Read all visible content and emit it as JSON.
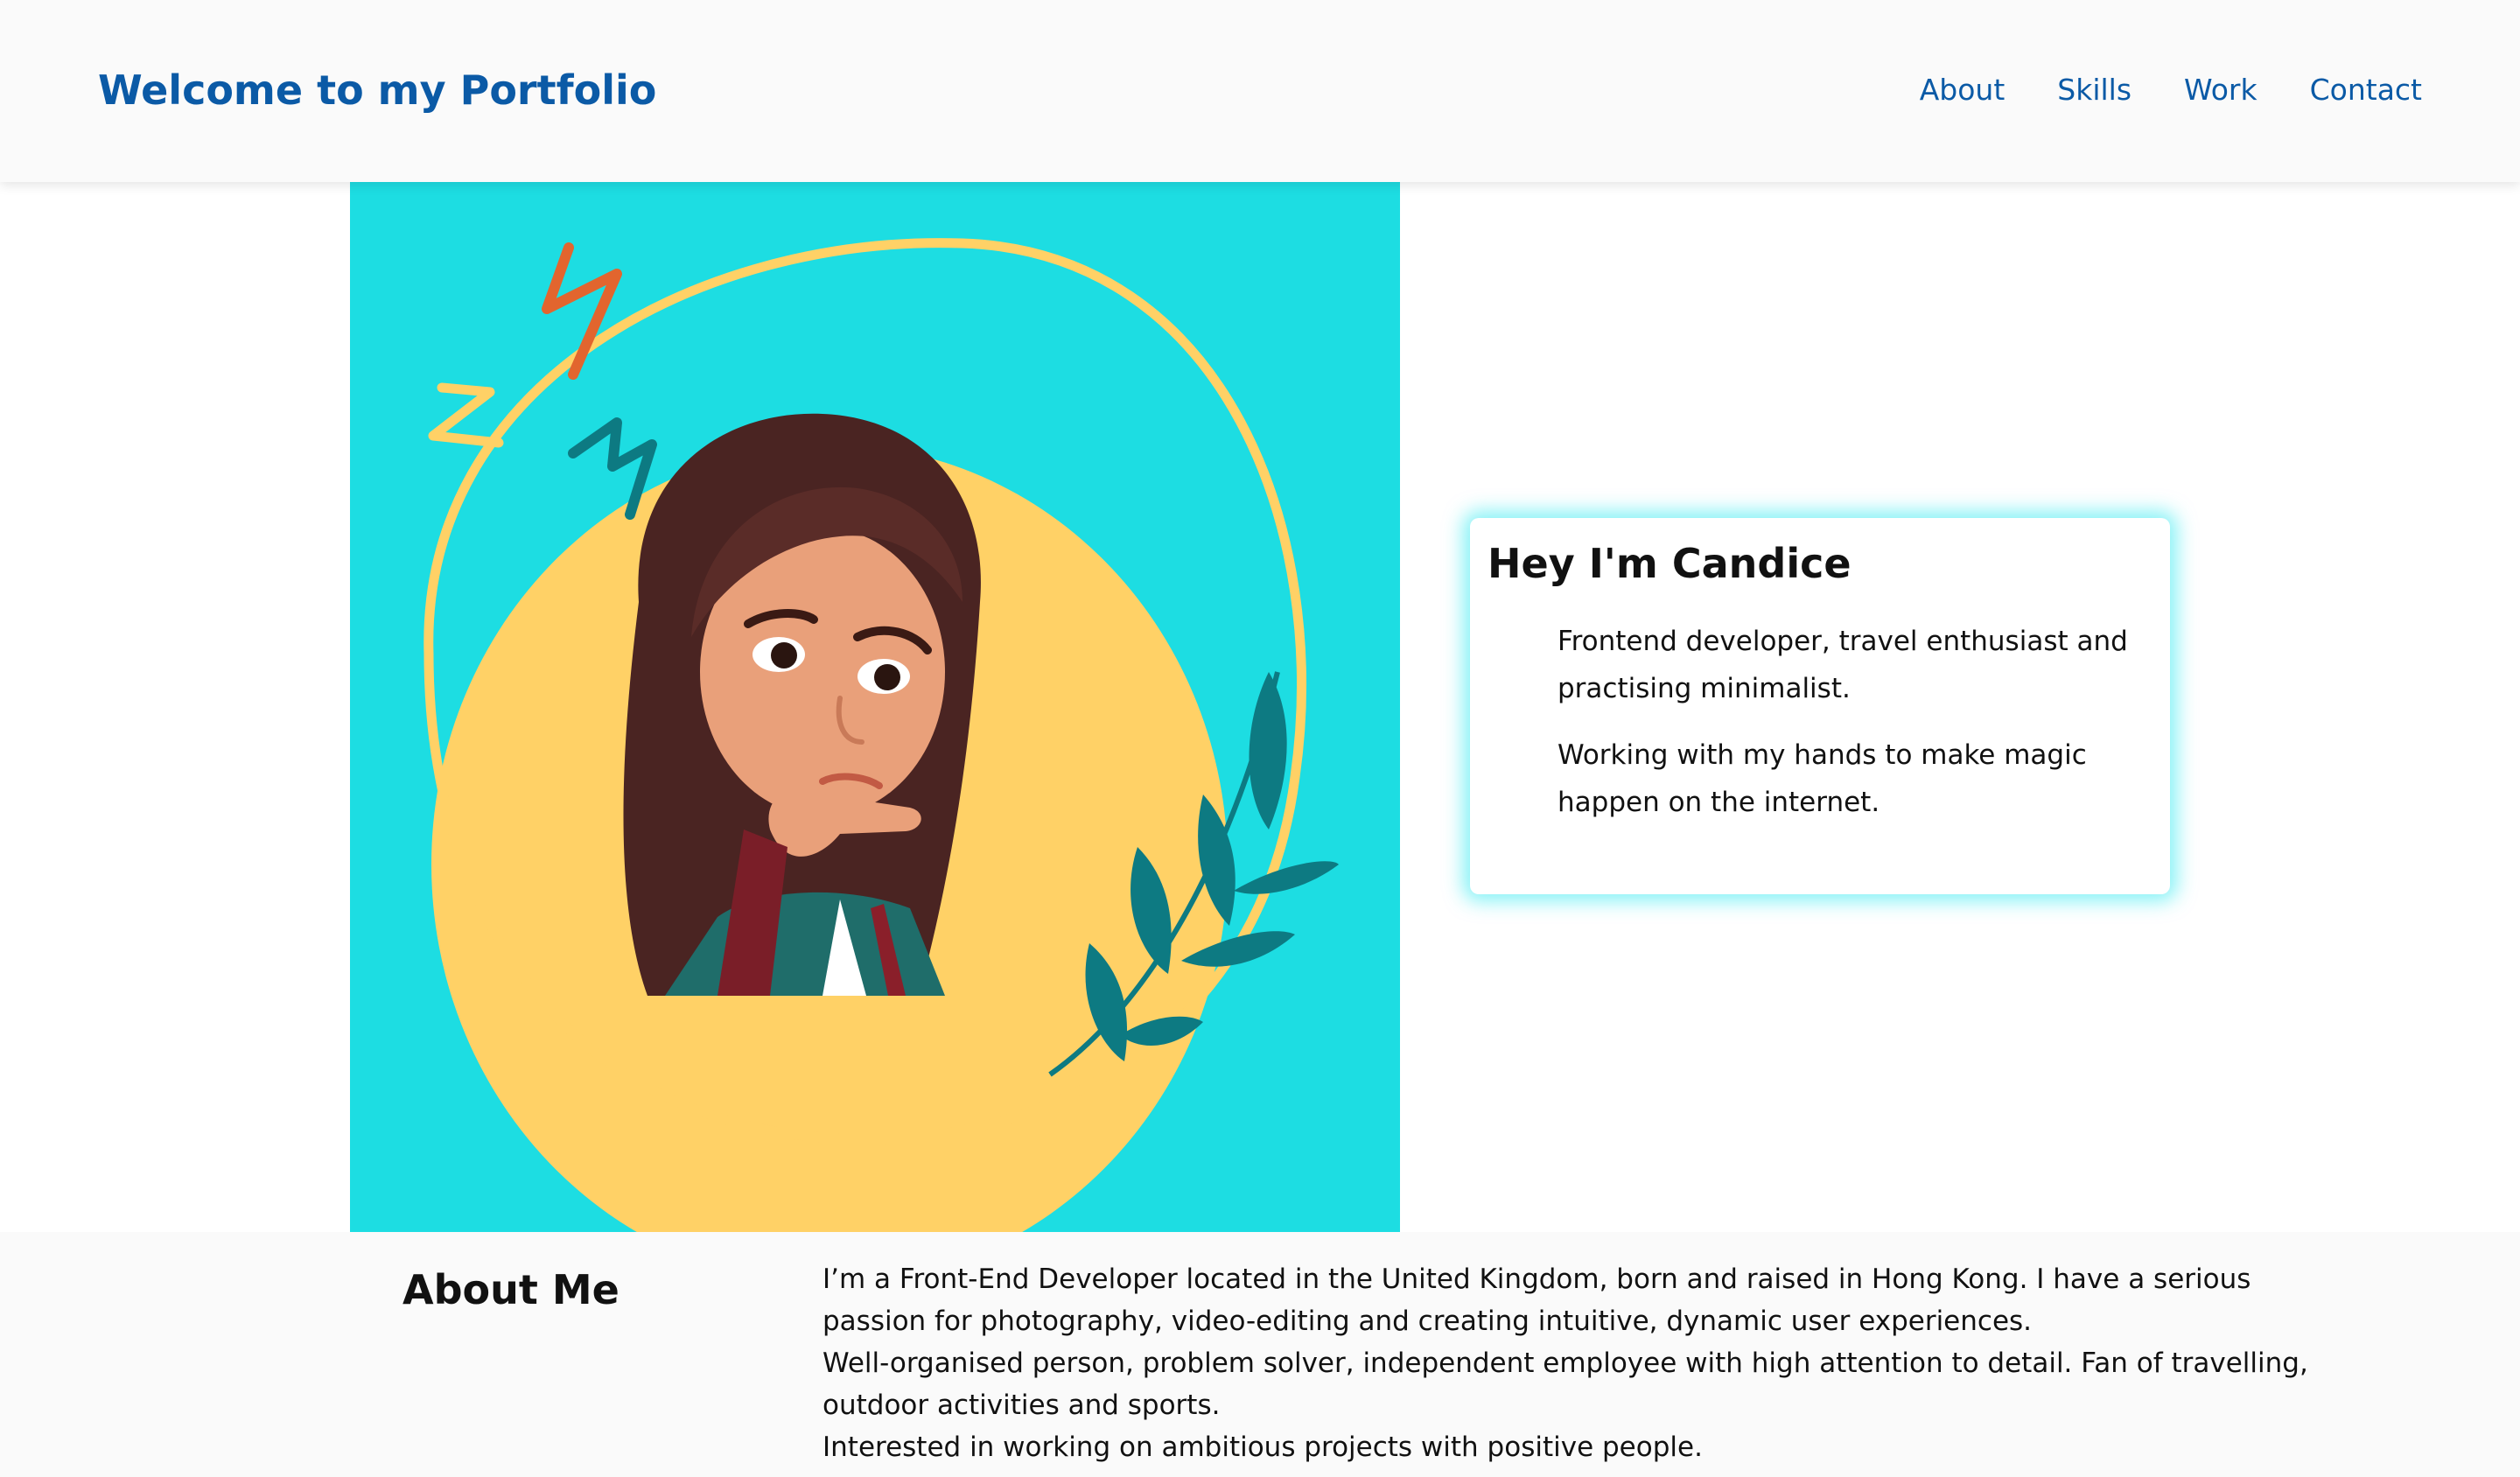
{
  "header": {
    "title": "Welcome to my Portfolio",
    "nav": [
      "About",
      "Skills",
      "Work",
      "Contact"
    ]
  },
  "hero": {
    "image_alt": "Cartoon avatar of a girl with long brown hair, hand on chin, on a turquoise background with a yellow circle",
    "colors": {
      "background": "#1ddde2",
      "circle": "#ffd166",
      "accent_orange": "#e2652e",
      "accent_teal": "#0d7a82",
      "title_blue": "#0b5aa6"
    }
  },
  "intro": {
    "heading": "Hey I'm Candice",
    "lines": [
      "Frontend developer, travel enthusiast and practising minimalist.",
      "Working with my hands to make magic happen on the internet."
    ]
  },
  "about": {
    "heading": "About Me",
    "paragraphs": [
      "I’m a Front-End Developer located in the United Kingdom, born and raised in Hong Kong. I have a serious passion for photography, video-editing and creating intuitive, dynamic user experiences.",
      "Well-organised person, problem solver, independent employee with high attention to detail. Fan of travelling, outdoor activities and sports.",
      "Interested in working on ambitious projects with positive people."
    ]
  }
}
